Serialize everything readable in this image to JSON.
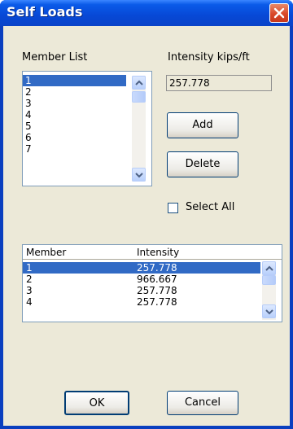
{
  "window": {
    "title": "Self Loads"
  },
  "member_list": {
    "label": "Member List",
    "items": [
      "1",
      "2",
      "3",
      "4",
      "5",
      "6",
      "7"
    ],
    "selected_index": 0
  },
  "intensity": {
    "label": "Intensity   kips/ft",
    "value": "257.778"
  },
  "buttons": {
    "add": "Add",
    "delete": "Delete",
    "ok": "OK",
    "cancel": "Cancel"
  },
  "select_all": {
    "label": "Select All",
    "checked": false
  },
  "loads_table": {
    "columns": [
      "Member",
      "Intensity"
    ],
    "rows": [
      [
        "1",
        "257.778"
      ],
      [
        "2",
        "966.667"
      ],
      [
        "3",
        "257.778"
      ],
      [
        "4",
        "257.778"
      ]
    ],
    "selected_index": 0
  },
  "colors": {
    "title_bar": "#0a5ae8",
    "selection": "#316ac5",
    "dialog_bg": "#ece9d8"
  }
}
